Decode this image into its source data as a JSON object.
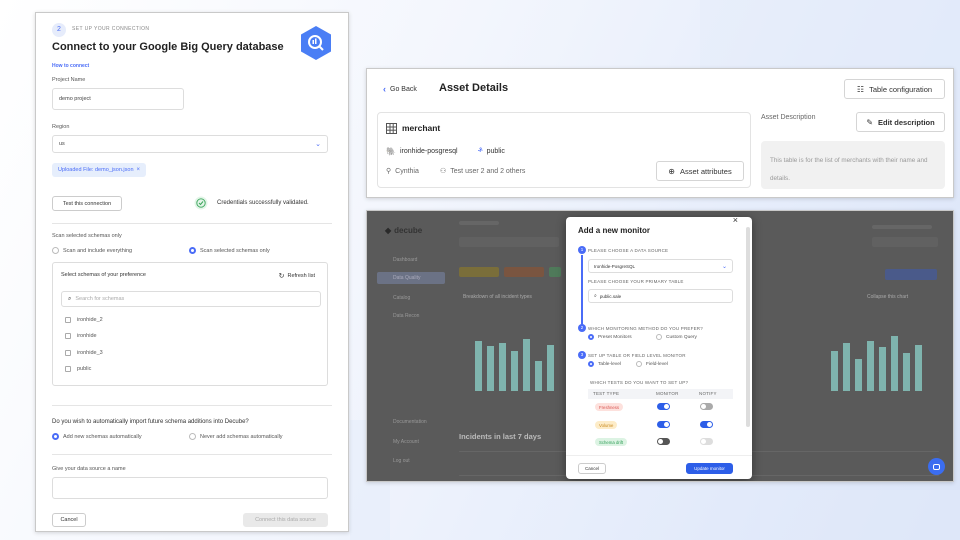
{
  "connect": {
    "step_num": "2",
    "step_label": "SET UP YOUR CONNECTION",
    "title": "Connect to your Google Big Query database",
    "how_link": "How to connect",
    "project_label": "Project Name",
    "project_value": "demo project",
    "region_label": "Region",
    "region_value": "us",
    "uploaded_chip": "Uploaded File: demo_json.json",
    "test_button": "Test this connection",
    "validated_text": "Credentials successfully validated.",
    "scan_label": "Scan selected schemas only",
    "scan_opt_all": "Scan and include everything",
    "scan_opt_selected": "Scan selected schemas only",
    "select_schemas_title": "Select schemas of your preference",
    "refresh": "Refresh list",
    "search_placeholder": "Search for schemas",
    "schemas": [
      "ironhide_2",
      "ironhide",
      "ironhide_3",
      "public"
    ],
    "import_question": "Do you wish to automatically import future schema additions into Decube?",
    "import_opt_add": "Add new schemas automatically",
    "import_opt_never": "Never add schemas automatically",
    "name_label": "Give your data source a name",
    "cancel": "Cancel",
    "connect_btn": "Connect this data source"
  },
  "asset": {
    "back": "Go Back",
    "title": "Asset Details",
    "table_config": "Table configuration",
    "name": "merchant",
    "source": "ironhide-posgresql",
    "schema": "public",
    "owner": "Cynthia",
    "users": "Test user 2 and 2 others",
    "attributes_btn": "Asset attributes",
    "desc_label": "Asset Description",
    "edit_desc": "Edit description",
    "desc_text": "This table is for the list of merchants with their name and details."
  },
  "app": {
    "logo": "decube",
    "nav": [
      "Dashboard",
      "Data Quality",
      "Catalog",
      "Data Recon"
    ],
    "nav_bottom": [
      "Documentation",
      "My Account",
      "Log out"
    ],
    "section_title": "Breakdown of all incident types",
    "collapse": "Collapse this chart",
    "incidents_title": "Incidents in last 7 days"
  },
  "modal": {
    "title": "Add a new monitor",
    "q1": "PLEASE CHOOSE A DATA SOURCE",
    "source_value": "Ironhide-PosgreSQL",
    "q_table": "PLEASE CHOOSE YOUR PRIMARY TABLE",
    "table_value": "public.sale",
    "q2": "WHICH MONITORING METHOD DO YOU PREFER?",
    "method_preset": "Preset Monitors",
    "method_custom": "Custom Query",
    "q3": "SET UP TABLE OR FIELD LEVEL MONITOR",
    "level_table": "Table-level",
    "level_field": "Field-level",
    "q_tests": "WHICH TESTS DO YOU WANT TO SET UP?",
    "col_type": "TEST TYPE",
    "col_monitor": "MONITOR",
    "col_notify": "NOTIFY",
    "tests": [
      {
        "name": "Freshness",
        "monitor": true,
        "notify": false,
        "color": "#fde1dd",
        "text": "#d9534f"
      },
      {
        "name": "Volume",
        "monitor": true,
        "notify": true,
        "color": "#fdecc8",
        "text": "#c7881c"
      },
      {
        "name": "Schema drift",
        "monitor": false,
        "notify": false,
        "color": "#dcf3e3",
        "text": "#2f9e57"
      }
    ],
    "cancel": "Cancel",
    "update": "Update monitor"
  }
}
